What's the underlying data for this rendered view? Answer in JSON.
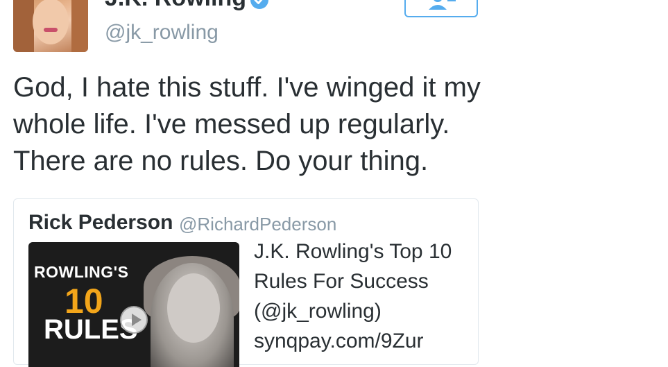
{
  "profile": {
    "name": "J.K. Rowling",
    "handle": "@jk_rowling"
  },
  "tweet": {
    "text": "God, I hate this stuff. I've winged it my whole life. I've messed up regularly. There are no rules. Do your thing."
  },
  "quoted_tweet": {
    "author": "Rick Pederson",
    "handle": "@RichardPederson",
    "thumbnail": {
      "title": "ROWLING'S",
      "number": "10",
      "rules": "RULES"
    },
    "card_line1": "J.K. Rowling's Top 10",
    "card_line2": "Rules For Success",
    "card_line3": "(@jk_rowling)",
    "card_line4": "synqpay.com/9Zur"
  },
  "colors": {
    "accent": "#55acee",
    "text": "#292f33",
    "muted": "#8899a6",
    "border": "#e1e8ed"
  },
  "icons": {
    "verified": "verified-badge-icon",
    "follow": "follow-user-icon",
    "play": "play-icon"
  }
}
